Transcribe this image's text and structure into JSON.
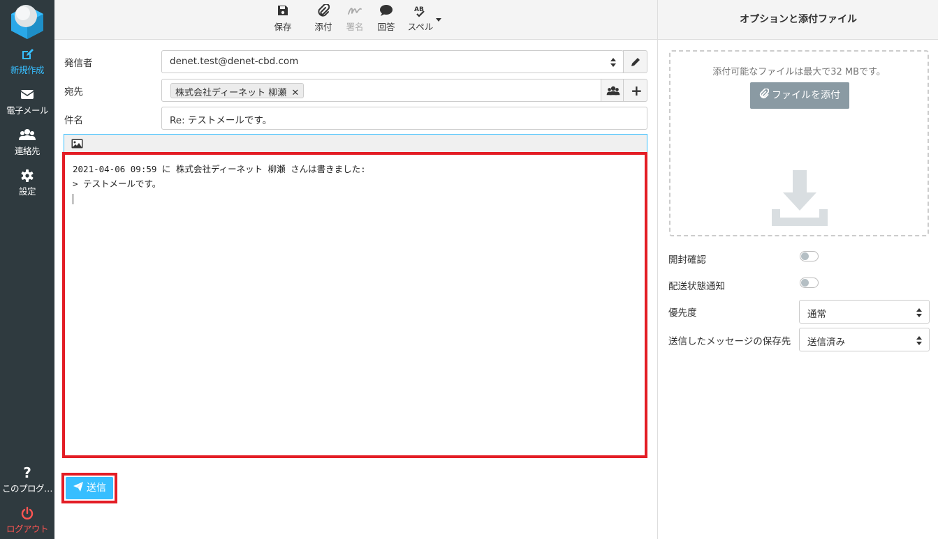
{
  "sidebar": {
    "items": [
      {
        "label": "新規作成",
        "icon": "compose-icon",
        "active": true
      },
      {
        "label": "電子メール",
        "icon": "envelope-icon"
      },
      {
        "label": "連絡先",
        "icon": "users-icon"
      },
      {
        "label": "設定",
        "icon": "gear-icon"
      }
    ],
    "about_label": "このプログ…",
    "logout_label": "ログアウト"
  },
  "toolbar": {
    "save_label": "保存",
    "attach_label": "添付",
    "signature_label": "署名",
    "response_label": "回答",
    "spell_label": "スペル"
  },
  "compose": {
    "from_label": "発信者",
    "from_value": "denet.test@denet-cbd.com",
    "to_label": "宛先",
    "to_recipient": "株式会社ディーネット 柳瀬",
    "subject_label": "件名",
    "subject_value": "Re: テストメールです。",
    "body_line1": "2021-04-06 09:59 に 株式会社ディーネット 柳瀬 さんは書きました:",
    "body_line2": "> テストメールです。",
    "send_label": "送信"
  },
  "options": {
    "title": "オプションと添付ファイル",
    "attach_hint": "添付可能なファイルは最大で32 MBです。",
    "attach_button": "ファイルを添付",
    "read_receipt_label": "開封確認",
    "dsn_label": "配送状態通知",
    "priority_label": "優先度",
    "priority_value": "通常",
    "save_sent_label": "送信したメッセージの保存先",
    "save_sent_value": "送信済み"
  },
  "colors": {
    "sidebar_bg": "#2f3a3f",
    "accent": "#37beff",
    "highlight": "#e31d25",
    "logout": "#ff5552"
  }
}
